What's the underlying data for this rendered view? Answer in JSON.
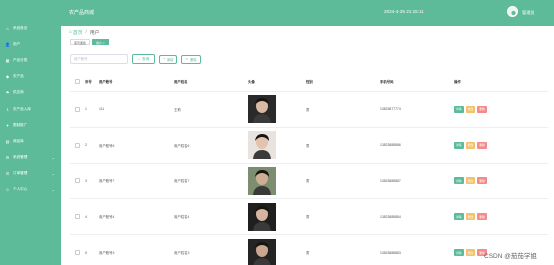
{
  "app": {
    "title": "农产品商城",
    "datetime": "2024-4-25 21:15:11",
    "user": "管理员"
  },
  "sidebar": {
    "items": [
      {
        "label": "系统首页",
        "icon": "home-icon",
        "expandable": false
      },
      {
        "label": "用户",
        "icon": "user-icon",
        "expandable": false
      },
      {
        "label": "产品分类",
        "icon": "category-icon",
        "expandable": false
      },
      {
        "label": "农产品",
        "icon": "product-icon",
        "expandable": false
      },
      {
        "label": "供应商",
        "icon": "supplier-icon",
        "expandable": false
      },
      {
        "label": "农产品入库",
        "icon": "inbound-icon",
        "expandable": false
      },
      {
        "label": "限制推广",
        "icon": "promotion-icon",
        "expandable": false
      },
      {
        "label": "商品库",
        "icon": "inventory-icon",
        "expandable": false
      },
      {
        "label": "系统管理",
        "icon": "settings-icon",
        "expandable": true
      },
      {
        "label": "订单管理",
        "icon": "order-icon",
        "expandable": true
      },
      {
        "label": "个人中心",
        "icon": "profile-icon",
        "expandable": true
      }
    ]
  },
  "breadcrumb": {
    "home": "首页",
    "current": "用户"
  },
  "tabs": [
    {
      "label": "首页面板",
      "active": false
    },
    {
      "label": "用户 ×",
      "active": true
    }
  ],
  "toolbar": {
    "search_placeholder": "用户账号",
    "search_label": "查询",
    "add_label": "新增",
    "delete_label": "删除"
  },
  "table": {
    "headers": [
      "序号",
      "用户账号",
      "用户姓名",
      "头像",
      "性别",
      "手机号码",
      "操作"
    ],
    "rows": [
      {
        "index": "1",
        "account": "111",
        "name": "王莉",
        "sex": "男",
        "phone": "13823877774"
      },
      {
        "index": "2",
        "account": "用户账号6",
        "name": "用户姓名6",
        "sex": "男",
        "phone": "13823888886"
      },
      {
        "index": "3",
        "account": "用户账号7",
        "name": "用户姓名7",
        "sex": "男",
        "phone": "13823888887"
      },
      {
        "index": "4",
        "account": "用户账号4",
        "name": "用户姓名4",
        "sex": "男",
        "phone": "13823888884"
      },
      {
        "index": "5",
        "account": "用户账号3",
        "name": "用户姓名3",
        "sex": "男",
        "phone": "13823888883"
      }
    ],
    "actions": {
      "detail": "详情",
      "edit": "修改",
      "delete": "删除"
    }
  },
  "watermark": "CSDN @茄茄学姐",
  "colors": {
    "primary": "#5dbb9a",
    "edit": "#f4c16c",
    "delete": "#f28b8b"
  }
}
